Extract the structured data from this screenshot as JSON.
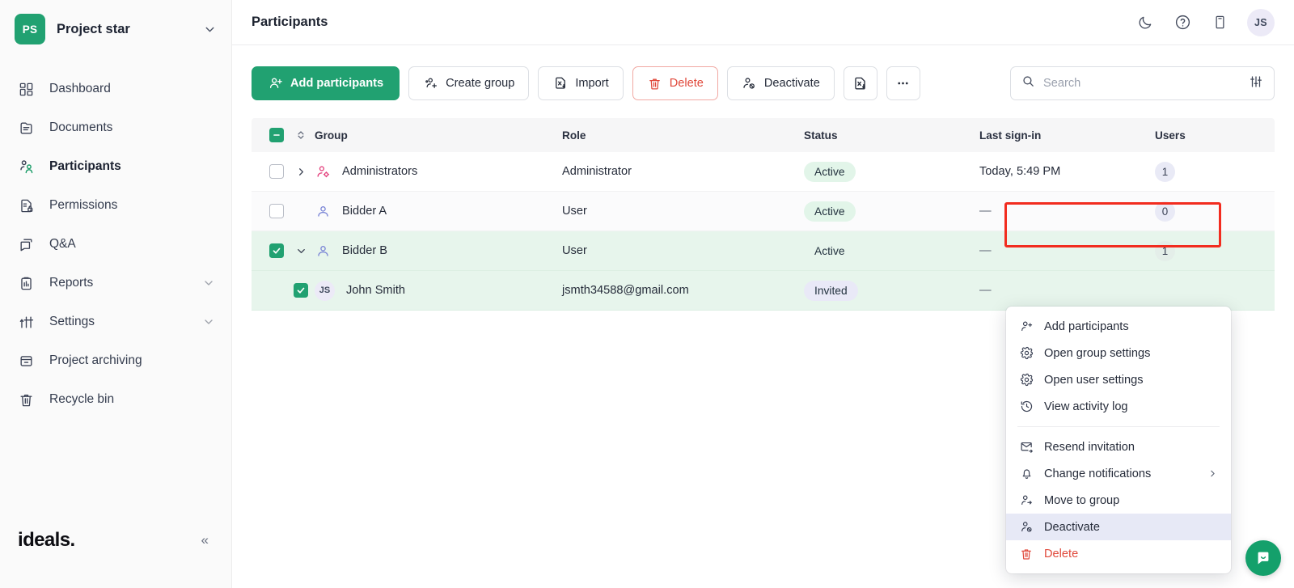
{
  "sidebar": {
    "project": {
      "initials": "PS",
      "name": "Project star",
      "chevron_icon": "chevron-down-icon"
    },
    "items": [
      {
        "label": "Dashboard",
        "icon": "dashboard-icon",
        "active": false,
        "expandable": false
      },
      {
        "label": "Documents",
        "icon": "document-icon",
        "active": false,
        "expandable": false
      },
      {
        "label": "Participants",
        "icon": "participants-icon",
        "active": true,
        "expandable": false
      },
      {
        "label": "Permissions",
        "icon": "permissions-lock-icon",
        "active": false,
        "expandable": false
      },
      {
        "label": "Q&A",
        "icon": "chat-bubble-icon",
        "active": false,
        "expandable": false
      },
      {
        "label": "Reports",
        "icon": "clipboard-chart-icon",
        "active": false,
        "expandable": true
      },
      {
        "label": "Settings",
        "icon": "sliders-icon",
        "active": false,
        "expandable": true
      },
      {
        "label": "Project archiving",
        "icon": "archive-box-icon",
        "active": false,
        "expandable": false
      },
      {
        "label": "Recycle bin",
        "icon": "trash-icon",
        "active": false,
        "expandable": false
      }
    ],
    "brand": "ideals.",
    "collapse_label": "«"
  },
  "topbar": {
    "title": "Participants",
    "icons": [
      "moon-icon",
      "help-circle-icon",
      "mobile-device-icon"
    ],
    "avatar_initials": "JS"
  },
  "toolbar": {
    "add_participants": "Add participants",
    "create_group": "Create group",
    "import": "Import",
    "delete": "Delete",
    "deactivate": "Deactivate",
    "export_icon": "export-excel-icon",
    "more_icon": "ellipsis-icon",
    "search_placeholder": "Search",
    "search_value": "",
    "filter_icon": "filter-sliders-icon"
  },
  "table": {
    "headers": [
      "Group",
      "Role",
      "Status",
      "Last sign-in",
      "Users"
    ],
    "header_checkbox_state": "indeterminate",
    "sort_icon": "sort-updown-icon",
    "rows": [
      {
        "name": "Administrators",
        "role": "Administrator",
        "status": "Active",
        "last_sign_in": "Today, 5:49 PM",
        "users": "1",
        "checked": false,
        "expanded": false,
        "expandable": true,
        "icon": "group-admin-icon",
        "type": "group",
        "selected": false,
        "zebra": false,
        "status_style": "pill"
      },
      {
        "name": "Bidder A",
        "role": "User",
        "status": "Active",
        "last_sign_in": "—",
        "users": "0",
        "checked": false,
        "expanded": false,
        "expandable": false,
        "icon": "group-user-icon",
        "type": "group",
        "selected": false,
        "zebra": true,
        "status_style": "pill"
      },
      {
        "name": "Bidder B",
        "role": "User",
        "status": "Active",
        "last_sign_in": "—",
        "users": "1",
        "checked": true,
        "expanded": true,
        "expandable": true,
        "icon": "group-user-icon",
        "type": "group",
        "selected": true,
        "zebra": false,
        "status_style": "plain"
      },
      {
        "name": "John Smith",
        "role": "jsmth34588@gmail.com",
        "status": "Invited",
        "last_sign_in": "—",
        "users": "",
        "checked": true,
        "expanded": false,
        "expandable": false,
        "icon": "avatar",
        "avatar_initials": "JS",
        "type": "user",
        "selected": true,
        "zebra": false,
        "status_style": "invited"
      }
    ]
  },
  "context_menu": {
    "groups": [
      [
        {
          "label": "Add participants",
          "icon": "add-participant-icon",
          "state": "normal"
        },
        {
          "label": "Open group settings",
          "icon": "gear-icon",
          "state": "normal"
        },
        {
          "label": "Open user settings",
          "icon": "gear-icon",
          "state": "normal"
        },
        {
          "label": "View activity log",
          "icon": "history-clock-icon",
          "state": "normal"
        }
      ],
      [
        {
          "label": "Resend invitation",
          "icon": "mail-send-icon",
          "state": "normal"
        },
        {
          "label": "Change notifications",
          "icon": "bell-icon",
          "state": "normal",
          "submenu": true,
          "submenu_icon": "chevron-right-icon"
        },
        {
          "label": "Move to group",
          "icon": "move-user-icon",
          "state": "normal"
        },
        {
          "label": "Deactivate",
          "icon": "deactivate-user-icon",
          "state": "highlighted"
        },
        {
          "label": "Delete",
          "icon": "trash-icon",
          "state": "danger"
        }
      ]
    ]
  },
  "annotation": {
    "highlight_color": "#f22c1f"
  },
  "chat_widget": {
    "icon": "chat-smile-icon",
    "color": "#14a06b"
  },
  "colors": {
    "accent_green": "#21a171",
    "danger_red": "#e0483a",
    "selected_row": "#e7f5ec",
    "admin_icon_pink": "#e4447f",
    "user_icon_blue": "#7b86d6"
  }
}
